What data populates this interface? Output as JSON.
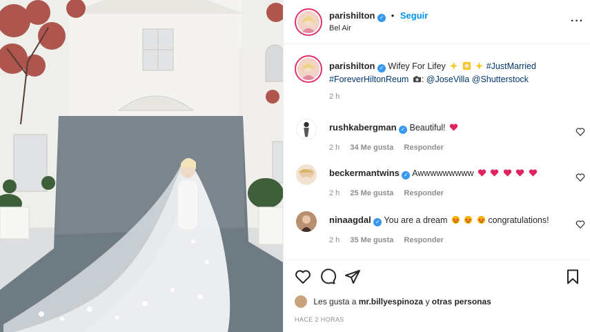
{
  "post_header": {
    "username": "parishilton",
    "follow_label": "Seguir",
    "location": "Bel Air",
    "more_icon": "ellipsis-icon"
  },
  "caption": {
    "username": "parishilton",
    "text": "Wifey For Lifey",
    "hashtag_1": "#JustMarried",
    "hashtag_2": "#ForeverHiltonReum",
    "camera_emoji": "camera-icon",
    "mention_1": "@JoseVilla",
    "mention_2": "@Shutterstock",
    "time": "2 h"
  },
  "comments": [
    {
      "username": "rushkabergman",
      "text": "Beautiful!",
      "time": "2 h",
      "likes": "34 Me gusta",
      "reply": "Responder"
    },
    {
      "username": "beckermantwins",
      "text": "Awwwwwwwww",
      "time": "2 h",
      "likes": "25 Me gusta",
      "reply": "Responder"
    },
    {
      "username": "ninaagdal",
      "text": "You are a dream",
      "text_after": "congratulations!",
      "time": "2 h",
      "likes": "35 Me gusta",
      "reply": "Responder"
    }
  ],
  "likes_line": {
    "prefix": "Les gusta a",
    "user": "mr.billyespinoza",
    "middle": "y",
    "suffix": "otras personas"
  },
  "posted_ago": "HACE 2 HORAS",
  "colors": {
    "link_blue": "#0095f6",
    "tag_blue": "#00376b",
    "heart_red": "#ed4956",
    "meta_gray": "#8e8e8e"
  }
}
